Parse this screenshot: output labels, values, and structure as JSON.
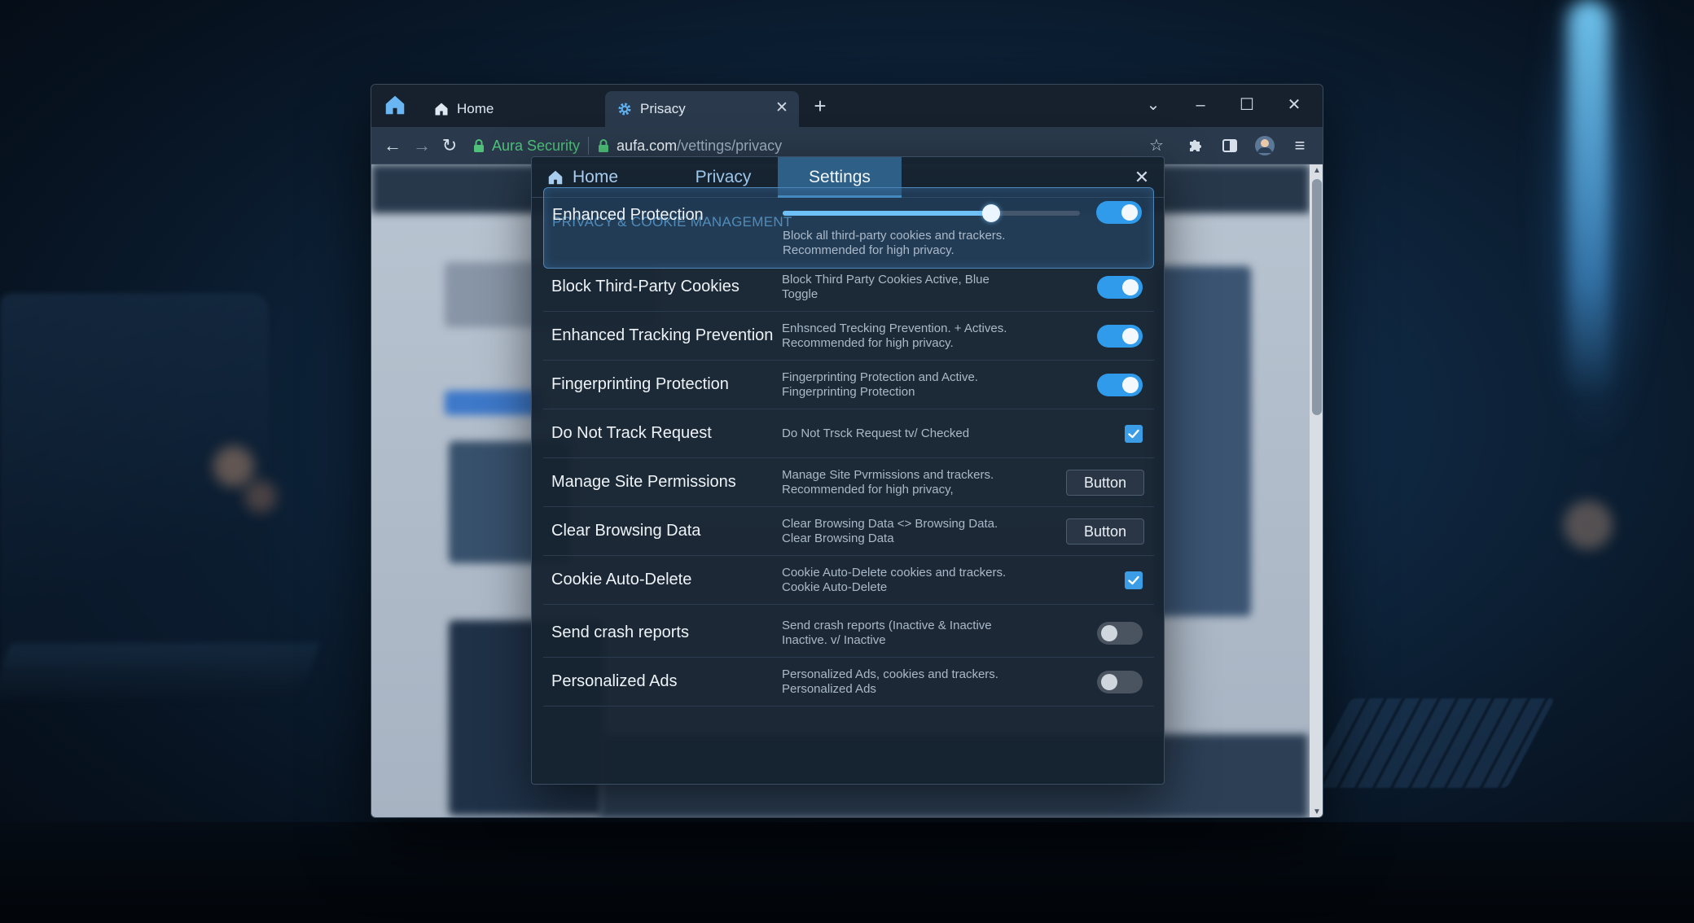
{
  "browser": {
    "tabs": [
      {
        "label": "Home",
        "active": false
      },
      {
        "label": "Prisacy",
        "active": true
      }
    ],
    "security_label": "Aura Security",
    "url_host": "aufa.com",
    "url_path": "/vettings/privacy",
    "icons": {
      "back": "arrow-left-icon",
      "forward": "arrow-right-icon",
      "reload": "reload-icon",
      "star": "star-icon",
      "extensions": "puzzle-icon",
      "sidepanel": "sidepanel-icon",
      "avatar": "avatar-icon",
      "menu": "menu-icon"
    }
  },
  "panel": {
    "tabs": [
      {
        "label": "Home"
      },
      {
        "label": "Privacy"
      },
      {
        "label": "Settings",
        "active": true
      }
    ],
    "section_title": "PRIVACY & COOKIE MANAGEMENT",
    "rows": [
      {
        "label": "Enhanced Protection",
        "desc": [
          "Block all third-party cookies and trackers.",
          "Recommended for high privacy."
        ],
        "control": "toggle",
        "state": true,
        "slider_value": 0.7
      },
      {
        "label": "Block Third-Party Cookies",
        "desc": [
          "Block Third Party Cookies Active, Blue",
          "Toggle"
        ],
        "control": "toggle",
        "state": true
      },
      {
        "label": "Enhanced Tracking Prevention",
        "desc": [
          "Enhsnced Trecking Prevention. + Actives.",
          "Recommended for high privacy."
        ],
        "control": "toggle",
        "state": true
      },
      {
        "label": "Fingerprinting Protection",
        "desc": [
          "Fingerprinting Protection and Active.",
          "Fingerprinting Protection"
        ],
        "control": "toggle",
        "state": true
      },
      {
        "label": "Do Not Track Request",
        "desc": [
          "Do Not Trsck Request tv/ Checked"
        ],
        "control": "checkbox",
        "state": true
      },
      {
        "label": "Manage Site Permissions",
        "desc": [
          "Manage Site Pvrmissions and trackers.",
          "Recommended for high privacy,"
        ],
        "control": "button",
        "button_label": "Button"
      },
      {
        "label": "Clear Browsing Data",
        "desc": [
          "Clear Browsing Data <> Browsing Data.",
          "Clear Browsing Data"
        ],
        "control": "button",
        "button_label": "Button"
      },
      {
        "label": "Cookie Auto-Delete",
        "desc": [
          "Cookie Auto-Delete cookies and trackers.",
          "Cookie Auto-Delete"
        ],
        "control": "checkbox",
        "state": true
      },
      {
        "label": "Send crash reports",
        "desc": [
          "Send crash reports (Inactive & Inactive",
          "Inactive. v/ Inactive"
        ],
        "control": "toggle",
        "state": false
      },
      {
        "label": "Personalized Ads",
        "desc": [
          "Personalized Ads, cookies and trackers.",
          "Personalized Ads"
        ],
        "control": "toggle",
        "state": false
      }
    ]
  },
  "colors": {
    "accent": "#2f9bea",
    "section_title": "#6cb8ef",
    "secure_green": "#4fc17a"
  }
}
